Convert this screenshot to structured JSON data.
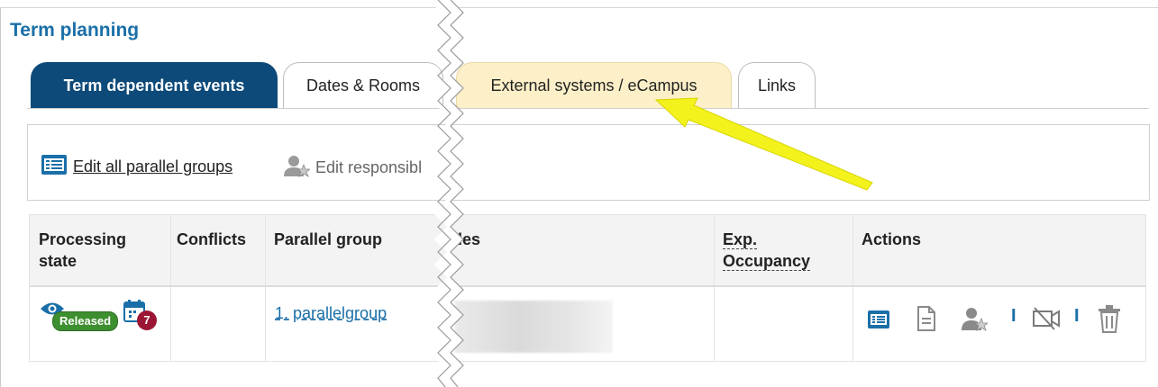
{
  "page": {
    "title": "Term planning"
  },
  "tabs": [
    {
      "label": "Term dependent events",
      "active": true
    },
    {
      "label": "Dates & Rooms",
      "active": false
    },
    {
      "label": "External systems / eCampus",
      "active": false,
      "highlighted": true
    },
    {
      "label": "Links",
      "active": false
    }
  ],
  "toolbar": {
    "edit_all_label": "Edit all parallel groups",
    "edit_responsible_label": "Edit responsibl"
  },
  "table": {
    "headers": {
      "processing_state": "Processing state",
      "conflicts": "Conflicts",
      "parallel_group": "Parallel group",
      "responsibles": "les",
      "exp_occupancy": "Exp. Occupancy",
      "actions": "Actions"
    },
    "rows": [
      {
        "status_badge": "Released",
        "date_count": "7",
        "parallel_group": "1. parallelgroup"
      }
    ]
  },
  "colors": {
    "title": "#1a6fa8",
    "active_tab": "#0d4a79",
    "highlight_tab": "#fdf0c8",
    "arrow": "#f4f21c",
    "released": "#3e8f2f",
    "date_badge": "#9b1634"
  },
  "icons": [
    "eye-icon",
    "calendar-icon",
    "list-icon",
    "document-icon",
    "user-star-icon",
    "no-video-icon",
    "trash-icon"
  ]
}
